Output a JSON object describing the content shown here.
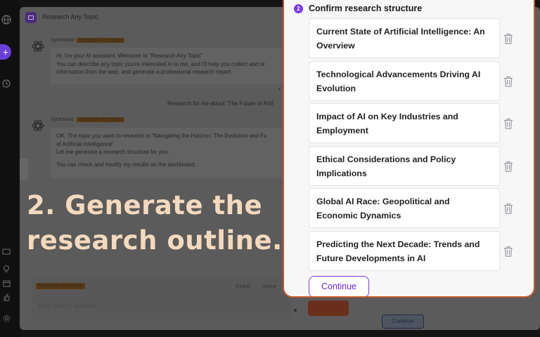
{
  "app": {
    "title": "Research Any Topic",
    "sender_name": "SynthMind",
    "sender_tag": "Research Any Topic",
    "messages": [
      {
        "lines": [
          "Hi, I'm your AI assistant. Welcome to \"Research Any Topic\"",
          "You can describe any topic you're interested in to me, and I'll help you collect and or",
          "information from the web, and generate a professional research report."
        ]
      },
      {
        "lines": [
          "OK. The topic you want to research is \"Navigating the Horizon: The Evolution and Fu",
          "of Artificial Intelligence\"",
          "Let me generate a research structure for you."
        ],
        "extra": "You can check and modify my results on the dashboard."
      }
    ],
    "user_message": "Research for me about \"The Future of Artif",
    "input": {
      "tag": "Research Any Topic",
      "placeholder": "Enter topic or question...",
      "option1": "Global",
      "option2": "Online"
    },
    "background_continue": "Continue"
  },
  "caption": {
    "line1": "2. Generate the",
    "line2": "research outline."
  },
  "modal": {
    "step_number": "2",
    "step_title": "Confirm research structure",
    "accent_color": "#7c3aed",
    "border_color": "#c2572a",
    "items": [
      "Current State of Artificial Intelligence: An Overview",
      "Technological Advancements Driving AI Evolution",
      "Impact of AI on Key Industries and Employment",
      "Ethical Considerations and Policy Implications",
      "Global AI Race: Geopolitical and Economic Dynamics",
      "Predicting the Next Decade: Trends and Future Developments in AI"
    ],
    "item_icon": "trash-icon",
    "continue_label": "Continue"
  }
}
